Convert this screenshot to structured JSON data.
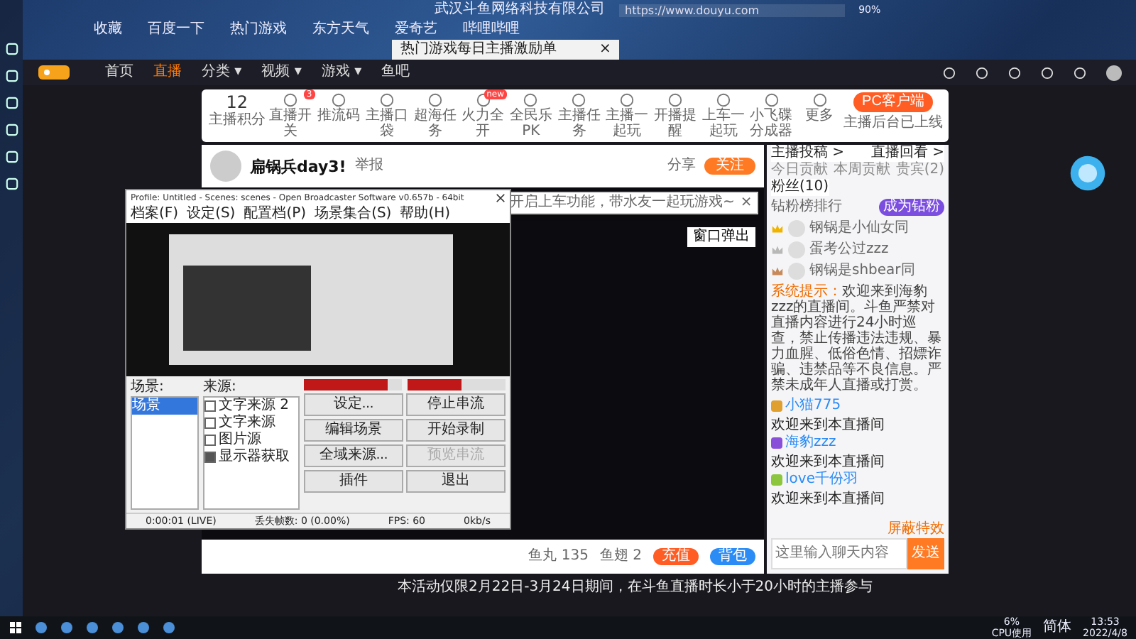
{
  "browser": {
    "site_name": "武汉斗鱼网络科技有限公司",
    "url": "https://www.douyu.com",
    "zoom": "90%",
    "bookmarks": [
      "收藏",
      "百度一下",
      "热门游戏",
      "东方天气",
      "爱奇艺",
      "哔哩哔哩"
    ],
    "tab": {
      "title": "热门游戏每日主播激励单",
      "close": "×"
    }
  },
  "site_nav": [
    {
      "label": "首页",
      "selected": false
    },
    {
      "label": "直播",
      "selected": true
    },
    {
      "label": "分类 ▾",
      "selected": false
    },
    {
      "label": "视频 ▾",
      "selected": false
    },
    {
      "label": "游戏 ▾",
      "selected": false
    },
    {
      "label": "鱼吧",
      "selected": false
    }
  ],
  "anchor_toolbar": {
    "points": "12",
    "points_label": "主播积分",
    "items": [
      {
        "label": "直播开关",
        "badge": "3"
      },
      {
        "label": "推流码"
      },
      {
        "label": "主播口袋"
      },
      {
        "label": "超海任务"
      },
      {
        "label": "火力全开",
        "badge": "new"
      },
      {
        "label": "全民乐PK"
      },
      {
        "label": "主播任务"
      },
      {
        "label": "主播一起玩"
      },
      {
        "label": "开播提醒"
      },
      {
        "label": "上车一起玩"
      },
      {
        "label": "小飞碟分成器"
      },
      {
        "label": "更多"
      }
    ],
    "client_button": "PC客户端",
    "client_note": "主播后台已上线"
  },
  "tooltip": {
    "text": "开启上车功能，带水友一起玩游戏~",
    "close": "×"
  },
  "streamer": {
    "name": "扁锅兵day3!",
    "report": "举报",
    "share": "分享",
    "follow": "关注"
  },
  "player": {
    "popout": "窗口弹出"
  },
  "gift_bar": {
    "fish_balls": "鱼丸 135",
    "fins": "鱼翅 2",
    "recharge": "充值",
    "backpack": "背包"
  },
  "chat": {
    "links": [
      "主播投稿 >",
      "直播回看 >"
    ],
    "tabs": [
      {
        "label": "今日贡献",
        "selected": false
      },
      {
        "label": "本周贡献",
        "selected": false
      },
      {
        "label": "贵宾(2)",
        "selected": false
      },
      {
        "label": "粉丝(10)",
        "selected": true
      }
    ],
    "fan_title": "钻粉榜排行",
    "fan_button": "成为钻粉",
    "ranking": [
      {
        "name": "钢锅是小仙女同",
        "color": "#f0b400"
      },
      {
        "name": "蛋考公过zzz",
        "color": "#b8b8b8"
      },
      {
        "name": "钢锅是shbear同",
        "color": "#c88a5a"
      }
    ],
    "system_label": "系统提示：",
    "system_text": "欢迎来到海豹zzz的直播间。斗鱼严禁对直播内容进行24小时巡查，禁止传播违法违规、暴力血腥、低俗色情、招嫖诈骗、违禁品等不良信息。严禁未成年人直播或打赏。",
    "messages": [
      {
        "user": "小猫775",
        "text": "欢迎来到本直播间",
        "color": "#e0a030"
      },
      {
        "user": "海豹zzz",
        "text": "欢迎来到本直播间",
        "color": "#8a4fd8"
      },
      {
        "user": "love千份羽",
        "text": "欢迎来到本直播间",
        "color": "#8cc63f"
      }
    ],
    "shield": "屏蔽特效",
    "placeholder": "这里输入聊天内容",
    "send": "发送"
  },
  "obs": {
    "title": "Profile: Untitled - Scenes: scenes - Open Broadcaster Software v0.657b - 64bit",
    "menu": [
      "档案(F)",
      "设定(S)",
      "配置档(P)",
      "场景集合(S)",
      "帮助(H)"
    ],
    "scenes_label": "场景:",
    "scenes": [
      {
        "label": "场景",
        "selected": true
      }
    ],
    "sources_label": "来源:",
    "sources": [
      {
        "label": "文字来源 2",
        "checked": false
      },
      {
        "label": "文字来源",
        "checked": false
      },
      {
        "label": "图片源",
        "checked": false
      },
      {
        "label": "显示器获取",
        "checked": true
      }
    ],
    "meters": [
      {
        "level": 0.85
      },
      {
        "level": 0.55
      }
    ],
    "buttons": [
      {
        "label": "设定...",
        "disabled": false
      },
      {
        "label": "停止串流",
        "disabled": false
      },
      {
        "label": "编辑场景",
        "disabled": false
      },
      {
        "label": "开始录制",
        "disabled": false
      },
      {
        "label": "全域来源...",
        "disabled": false
      },
      {
        "label": "预览串流",
        "disabled": true
      },
      {
        "label": "插件",
        "disabled": false
      },
      {
        "label": "退出",
        "disabled": false
      }
    ],
    "status": [
      "0:00:01 (LIVE)",
      "丢失帧数: 0 (0.00%)",
      "FPS: 60",
      "0kb/s"
    ]
  },
  "notice": "本活动仅限2月22日-3月24日期间，在斗鱼直播时长小于20小时的主播参与",
  "taskbar": {
    "cpu": "6%",
    "cpu_label": "CPU使用",
    "ime": "简体",
    "time": "13:53",
    "date": "2022/4/8"
  }
}
